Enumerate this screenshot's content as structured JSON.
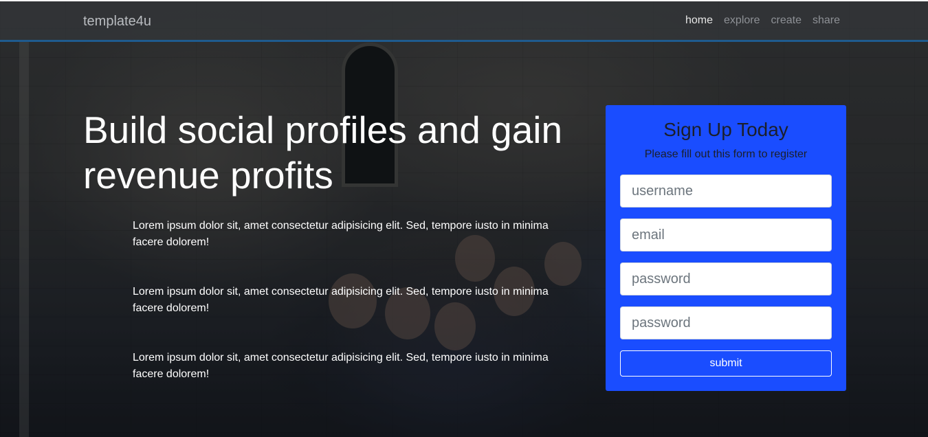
{
  "navbar": {
    "brand": "template4u",
    "links": [
      {
        "label": "home",
        "active": true
      },
      {
        "label": "explore",
        "active": false
      },
      {
        "label": "create",
        "active": false
      },
      {
        "label": "share",
        "active": false
      }
    ]
  },
  "hero": {
    "title": "Build social profiles and gain revenue profits",
    "paragraphs": [
      "Lorem ipsum dolor sit, amet consectetur adipisicing elit. Sed, tempore iusto in minima facere dolorem!",
      "Lorem ipsum dolor sit, amet consectetur adipisicing elit. Sed, tempore iusto in minima facere dolorem!",
      "Lorem ipsum dolor sit, amet consectetur adipisicing elit. Sed, tempore iusto in minima facere dolorem!"
    ]
  },
  "signup": {
    "title": "Sign Up Today",
    "subtitle": "Please fill out this form to register",
    "fields": [
      {
        "name": "username",
        "placeholder": "username",
        "value": ""
      },
      {
        "name": "email",
        "placeholder": "email",
        "value": ""
      },
      {
        "name": "password",
        "placeholder": "password",
        "value": ""
      },
      {
        "name": "confirm-password",
        "placeholder": "password",
        "value": ""
      }
    ],
    "submit_label": "submit"
  },
  "colors": {
    "card_background": "#1a4dff",
    "navbar_border": "#1f5b8f"
  }
}
